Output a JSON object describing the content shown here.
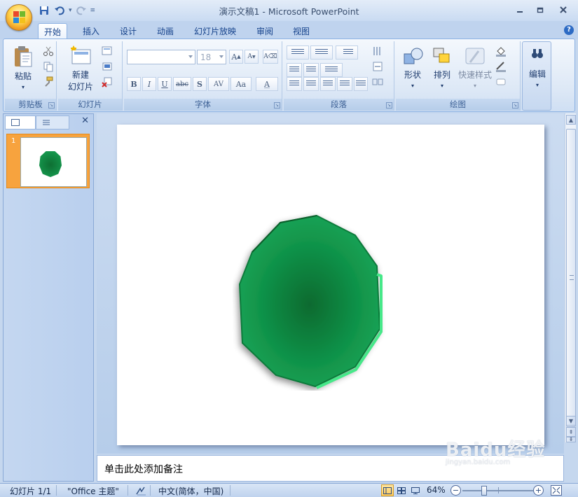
{
  "window": {
    "title": "演示文稿1 - Microsoft PowerPoint",
    "minimize_icon": "minimize-icon",
    "maximize_icon": "restore-icon",
    "close_icon": "close-icon"
  },
  "quick_access": {
    "save": "save-icon",
    "undo": "undo-icon",
    "redo": "redo-icon",
    "customize": "dropdown-icon"
  },
  "tabs": [
    {
      "label": "开始",
      "active": true
    },
    {
      "label": "插入",
      "active": false
    },
    {
      "label": "设计",
      "active": false
    },
    {
      "label": "动画",
      "active": false
    },
    {
      "label": "幻灯片放映",
      "active": false
    },
    {
      "label": "审阅",
      "active": false
    },
    {
      "label": "视图",
      "active": false
    }
  ],
  "ribbon": {
    "clipboard": {
      "label": "剪贴板",
      "paste": "粘贴"
    },
    "slides": {
      "label": "幻灯片",
      "new_slide_line1": "新建",
      "new_slide_line2": "幻灯片"
    },
    "font": {
      "label": "字体",
      "font_name": "",
      "font_size": "18",
      "bold": "B",
      "italic": "I",
      "underline": "U",
      "strike": "abc",
      "shadow": "S",
      "spacing": "AV",
      "case": "Aa",
      "color": "A"
    },
    "paragraph": {
      "label": "段落"
    },
    "drawing": {
      "label": "绘图",
      "shapes": "形状",
      "arrange": "排列",
      "quick_styles": "快速样式"
    },
    "editing": {
      "label": "编辑"
    }
  },
  "slides_pane": {
    "tab_slides_icon": "slides-tab-icon",
    "tab_outline_icon": "outline-tab-icon",
    "close": "✕",
    "thumbnail_number": "1"
  },
  "slide": {
    "shape": "decagon",
    "fill_center": "#0a6a2f",
    "fill_edge": "#18a356",
    "bevel_highlight": "#45e88a"
  },
  "notes": {
    "placeholder": "单击此处添加备注"
  },
  "statusbar": {
    "slide_info": "幻灯片 1/1",
    "theme": "\"Office 主题\"",
    "language": "中文(简体，中国)",
    "zoom": "64%",
    "zoom_level": 0.64
  },
  "watermark": {
    "brand": "Baidu经验",
    "sub": "jingyan.baidu.com"
  },
  "colors": {
    "accent": "#15428b",
    "ribbon_border": "#8db2e3",
    "selected_thumb": "#f7a33e"
  }
}
